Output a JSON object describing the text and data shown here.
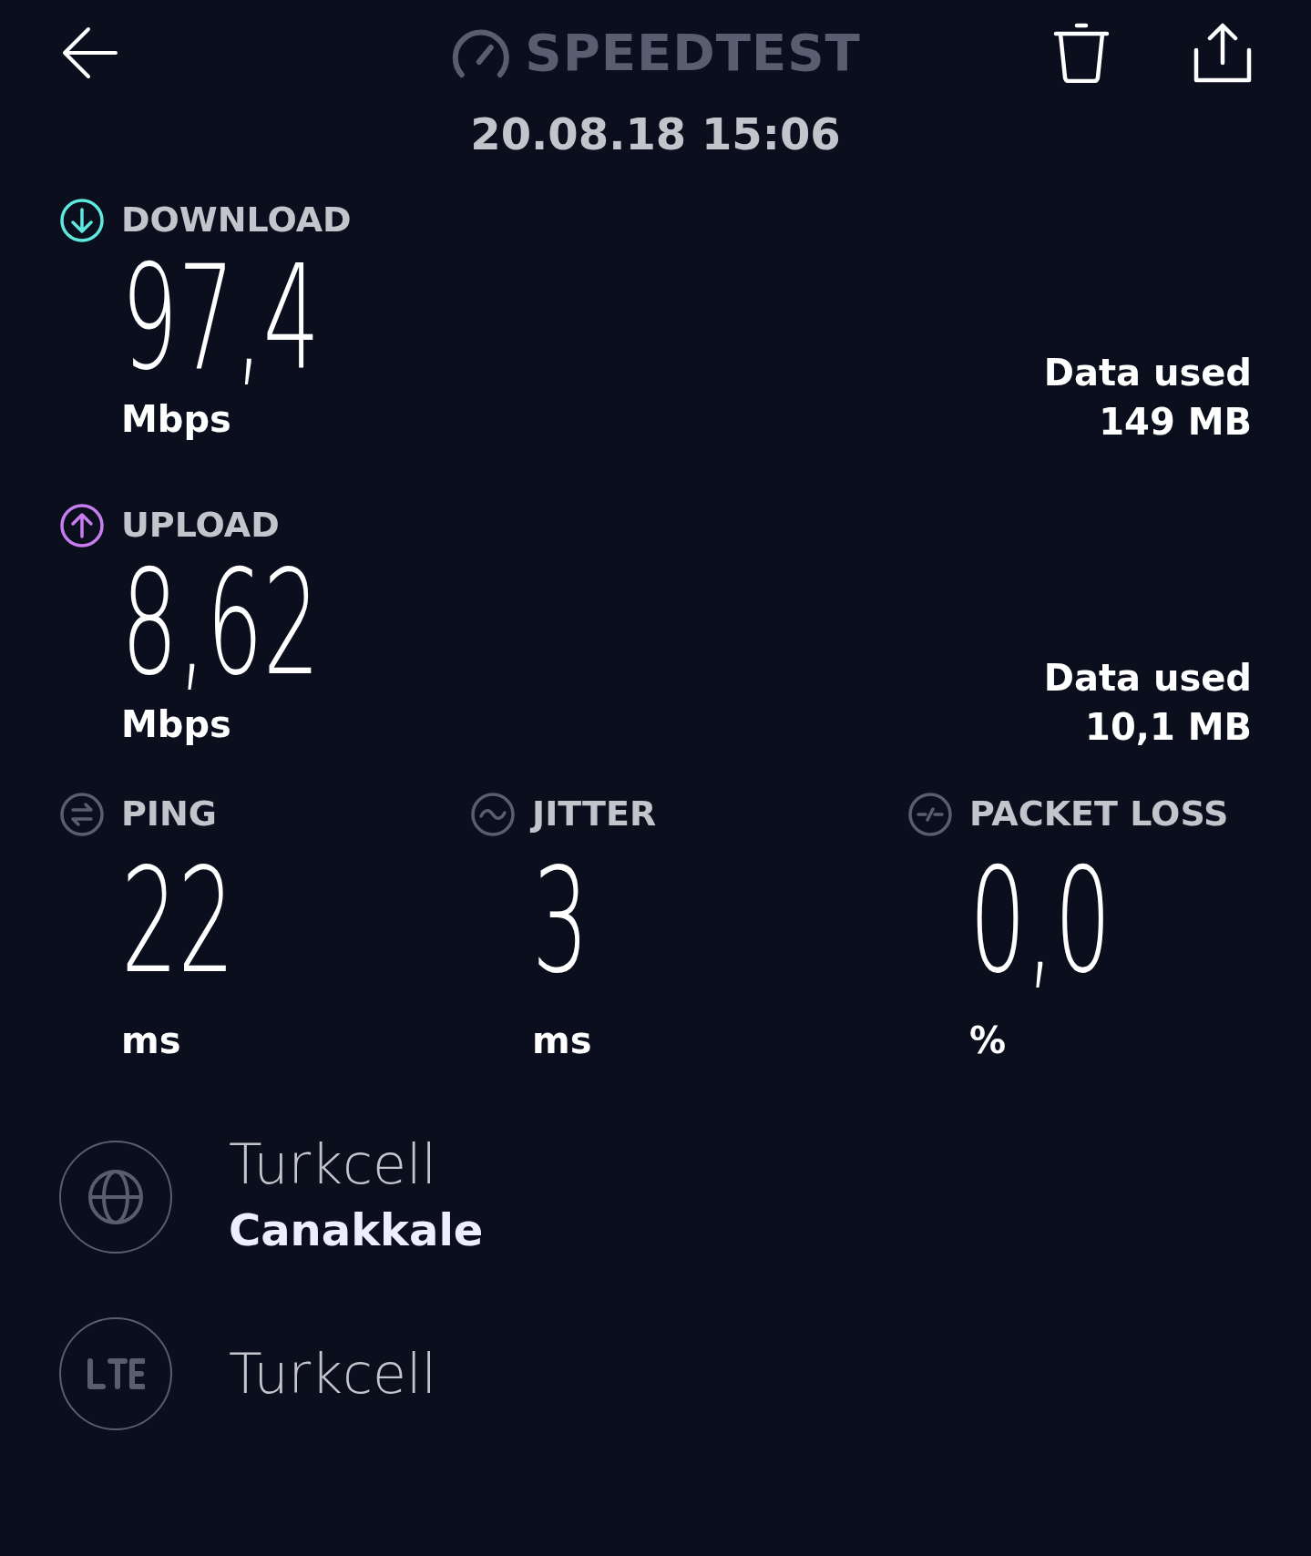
{
  "header": {
    "title": "SPEEDTEST",
    "date": "20.08.18 15:06"
  },
  "results": [
    {
      "kind": "download",
      "label": "DOWNLOAD",
      "value": "97,4",
      "unit": "Mbps",
      "data_used_label": "Data used",
      "data_used": "149 MB",
      "color": "#5ee8de"
    },
    {
      "kind": "upload",
      "label": "UPLOAD",
      "value": "8,62",
      "unit": "Mbps",
      "data_used_label": "Data used",
      "data_used": "10,1 MB",
      "color": "#c77df0"
    }
  ],
  "metrics": [
    {
      "kind": "ping",
      "label": "PING",
      "value": "22",
      "unit": "ms"
    },
    {
      "kind": "jitter",
      "label": "JITTER",
      "value": "3",
      "unit": "ms"
    },
    {
      "kind": "loss",
      "label": "PACKET LOSS",
      "value": "0,0",
      "unit": "%"
    }
  ],
  "servers": [
    {
      "kind": "server",
      "name": "Turkcell",
      "location": "Canakkale"
    },
    {
      "kind": "network",
      "name": "Turkcell"
    }
  ]
}
